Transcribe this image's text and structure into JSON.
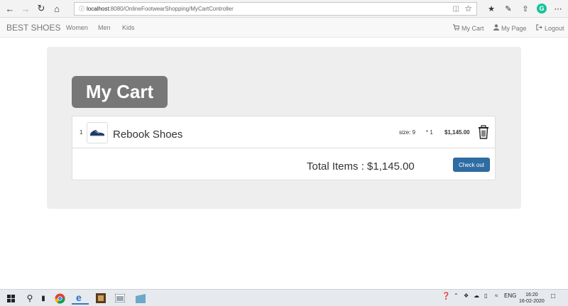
{
  "browser": {
    "url_host": "localhost",
    "url_path": ":8080/OnlineFootwearShopping/MyCartController"
  },
  "navbar": {
    "brand": "BEST SHOES",
    "links": [
      "Women",
      "Men",
      "Kids"
    ],
    "right": [
      {
        "icon": "cart-icon",
        "label": "My Cart"
      },
      {
        "icon": "user-icon",
        "label": "My Page"
      },
      {
        "icon": "logout-icon",
        "label": "Logout"
      }
    ]
  },
  "cart": {
    "title": "My Cart",
    "items": [
      {
        "index": "1",
        "name": "Rebook Shoes",
        "size": "size: 9",
        "qty": "* 1",
        "price": "$1,145.00"
      }
    ],
    "total_label": "Total Items : $1,145.00",
    "checkout_label": "Check out"
  },
  "taskbar": {
    "lang": "ENG",
    "time": "16:20",
    "date": "16-02-2020"
  },
  "colors": {
    "jumbotron": "#eeeeee",
    "title_bg": "#777777",
    "checkout_bg": "#2e6da4"
  }
}
